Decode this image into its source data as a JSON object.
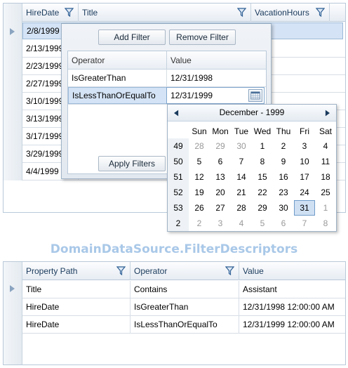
{
  "top_grid": {
    "columns": [
      "HireDate",
      "Title",
      "VacationHours"
    ],
    "rows": [
      "2/8/1999",
      "2/13/1999",
      "2/23/1999",
      "2/27/1999",
      "3/10/1999",
      "3/13/1999",
      "3/17/1999",
      "3/29/1999",
      "4/4/1999"
    ]
  },
  "filter_popup": {
    "add_label": "Add Filter",
    "remove_label": "Remove Filter",
    "apply_label": "Apply Filters",
    "headers": [
      "Operator",
      "Value"
    ],
    "rows": [
      {
        "operator": "IsGreaterThan",
        "value": "12/31/1998"
      },
      {
        "operator": "IsLessThanOrEqualTo",
        "value": "12/31/1999"
      }
    ]
  },
  "calendar": {
    "month_label": "December - 1999",
    "day_names": [
      "Sun",
      "Mon",
      "Tue",
      "Wed",
      "Thu",
      "Fri",
      "Sat"
    ],
    "weeks": [
      {
        "week": "49",
        "days": [
          "28",
          "29",
          "30",
          "1",
          "2",
          "3",
          "4"
        ]
      },
      {
        "week": "50",
        "days": [
          "5",
          "6",
          "7",
          "8",
          "9",
          "10",
          "11"
        ]
      },
      {
        "week": "51",
        "days": [
          "12",
          "13",
          "14",
          "15",
          "16",
          "17",
          "18"
        ]
      },
      {
        "week": "52",
        "days": [
          "19",
          "20",
          "21",
          "22",
          "23",
          "24",
          "25"
        ]
      },
      {
        "week": "53",
        "days": [
          "26",
          "27",
          "28",
          "29",
          "30",
          "31",
          "1"
        ]
      },
      {
        "week": "2",
        "days": [
          "2",
          "3",
          "4",
          "5",
          "6",
          "7",
          "8"
        ]
      }
    ],
    "selected_day": "31"
  },
  "section_title": "DomainDataSource.FilterDescriptors",
  "bottom_grid": {
    "columns": [
      "Property Path",
      "Operator",
      "Value"
    ],
    "rows": [
      {
        "path": "Title",
        "operator": "Contains",
        "value": "Assistant"
      },
      {
        "path": "HireDate",
        "operator": "IsGreaterThan",
        "value": "12/31/1998 12:00:00 AM"
      },
      {
        "path": "HireDate",
        "operator": "IsLessThanOrEqualTo",
        "value": "12/31/1999 12:00:00 AM"
      }
    ]
  },
  "colors": {
    "accent": "#a9c8e8",
    "selection": "#d4e3f5",
    "border": "#b9c9d9"
  }
}
